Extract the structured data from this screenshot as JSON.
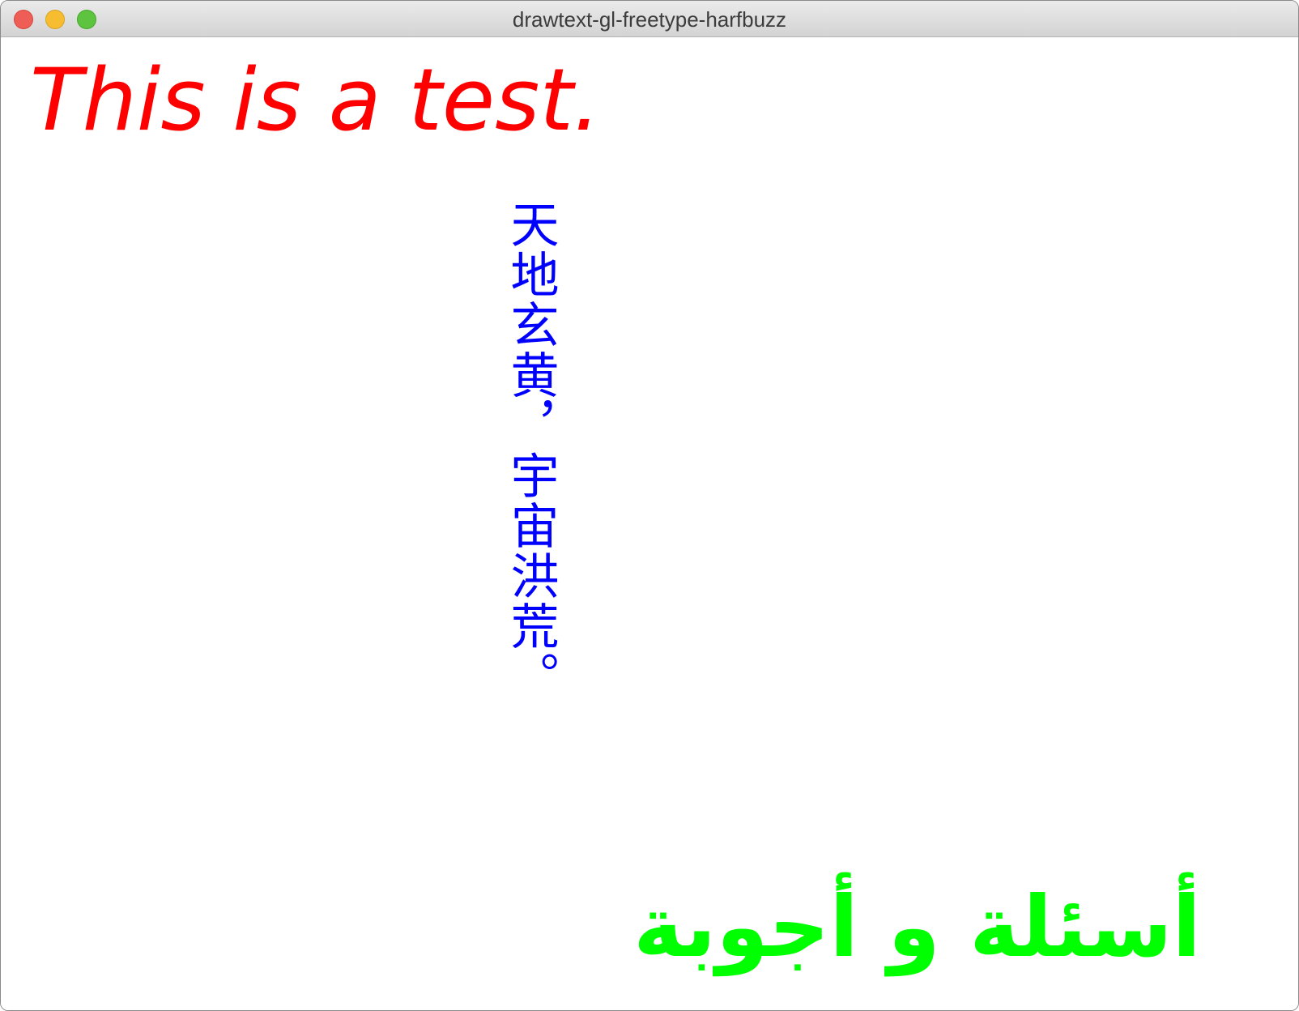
{
  "window": {
    "title": "drawtext-gl-freetype-harfbuzz"
  },
  "content": {
    "latin_text": "This is a test.",
    "cjk_text": "天地玄黄，宇宙洪荒。",
    "arabic_text": "أسئلة و أجوبة"
  },
  "colors": {
    "latin_text": "#ff0000",
    "cjk_text": "#0000ff",
    "arabic_text": "#00ff00"
  }
}
